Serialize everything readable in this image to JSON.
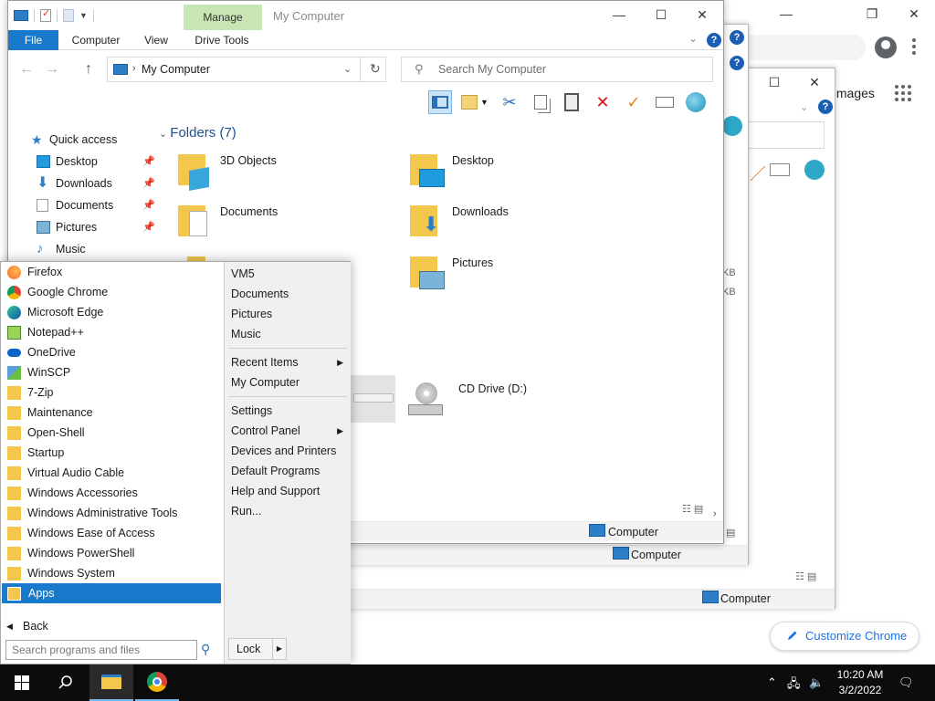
{
  "chrome": {
    "images_link": "Images",
    "customize_label": "Customize Chrome"
  },
  "back_windows": {
    "status_computer_1": "Computer",
    "status_computer_2": "Computer",
    "size_1": "KB",
    "size_2": "KB"
  },
  "explorer": {
    "title": "My Computer",
    "manage_tab": "Manage",
    "tabs": [
      "File",
      "Computer",
      "View",
      "Drive Tools"
    ],
    "address": "My Computer",
    "search_placeholder": "Search My Computer",
    "folders_heading": "Folders (7)",
    "nav": {
      "quick_access": "Quick access",
      "items": [
        "Desktop",
        "Downloads",
        "Documents",
        "Pictures",
        "Music"
      ]
    },
    "folders": [
      "3D Objects",
      "Desktop",
      "Documents",
      "Downloads",
      "Pictures"
    ],
    "drive": "CD Drive (D:)",
    "status_computer": "Computer"
  },
  "start_menu": {
    "programs": [
      "Firefox",
      "Google Chrome",
      "Microsoft Edge",
      "Notepad++",
      "OneDrive",
      "WinSCP",
      "7-Zip",
      "Maintenance",
      "Open-Shell",
      "Startup",
      "Virtual Audio Cable",
      "Windows Accessories",
      "Windows Administrative Tools",
      "Windows Ease of Access",
      "Windows PowerShell",
      "Windows System",
      "Apps"
    ],
    "back": "Back",
    "search_placeholder": "Search programs and files",
    "right_group1": [
      "VM5",
      "Documents",
      "Pictures",
      "Music"
    ],
    "right_group2": [
      "Recent Items",
      "My Computer"
    ],
    "right_group3": [
      "Settings",
      "Control Panel",
      "Devices and Printers",
      "Default Programs",
      "Help and Support",
      "Run..."
    ],
    "lock": "Lock"
  },
  "taskbar": {
    "time": "10:20 AM",
    "date": "3/2/2022"
  },
  "colors": {
    "accent": "#1979ca",
    "manage_tab": "#c8e6b4",
    "folder_yellow": "#f3c74c",
    "taskbar": "#0c0c0c"
  }
}
